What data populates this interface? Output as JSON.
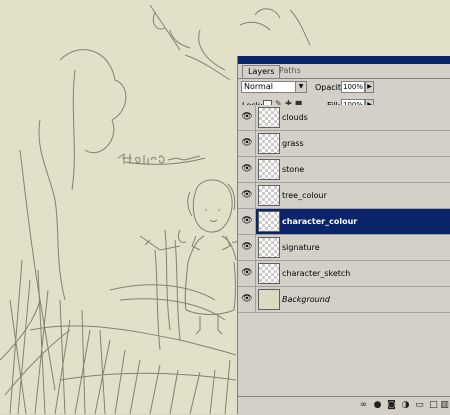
{
  "panel": {
    "tabs": [
      "Layers",
      "Paths"
    ],
    "blend_mode": "Normal",
    "opacity_label": "Opacity:",
    "opacity_value": "100%",
    "lock_label": "Lock:",
    "fill_label": "Fill:",
    "fill_value": "100%"
  },
  "layers": [
    {
      "name": "clouds",
      "visible": true,
      "selected": false
    },
    {
      "name": "grass",
      "visible": true,
      "selected": false
    },
    {
      "name": "stone",
      "visible": true,
      "selected": false
    },
    {
      "name": "tree_colour",
      "visible": true,
      "selected": false
    },
    {
      "name": "character_colour",
      "visible": true,
      "selected": true
    },
    {
      "name": "signature",
      "visible": true,
      "selected": false
    },
    {
      "name": "character_sketch",
      "visible": true,
      "selected": false
    },
    {
      "name": "Background",
      "visible": true,
      "selected": false
    }
  ],
  "icons": {
    "eye": "eye-icon",
    "lock_transparent": "lock-transparent-icon",
    "lock_image": "brush-lock-icon",
    "lock_position": "move-lock-icon",
    "lock_all": "padlock-icon",
    "link": "link-icon",
    "fx": "layer-style-icon",
    "mask": "layer-mask-icon",
    "adjust": "adjustment-layer-icon",
    "folder": "group-folder-icon",
    "new": "new-layer-icon",
    "trash": "trash-icon"
  },
  "colors": {
    "canvas": "#e2e0c9",
    "panel": "#d4d0c8",
    "selection": "#0a246a"
  }
}
